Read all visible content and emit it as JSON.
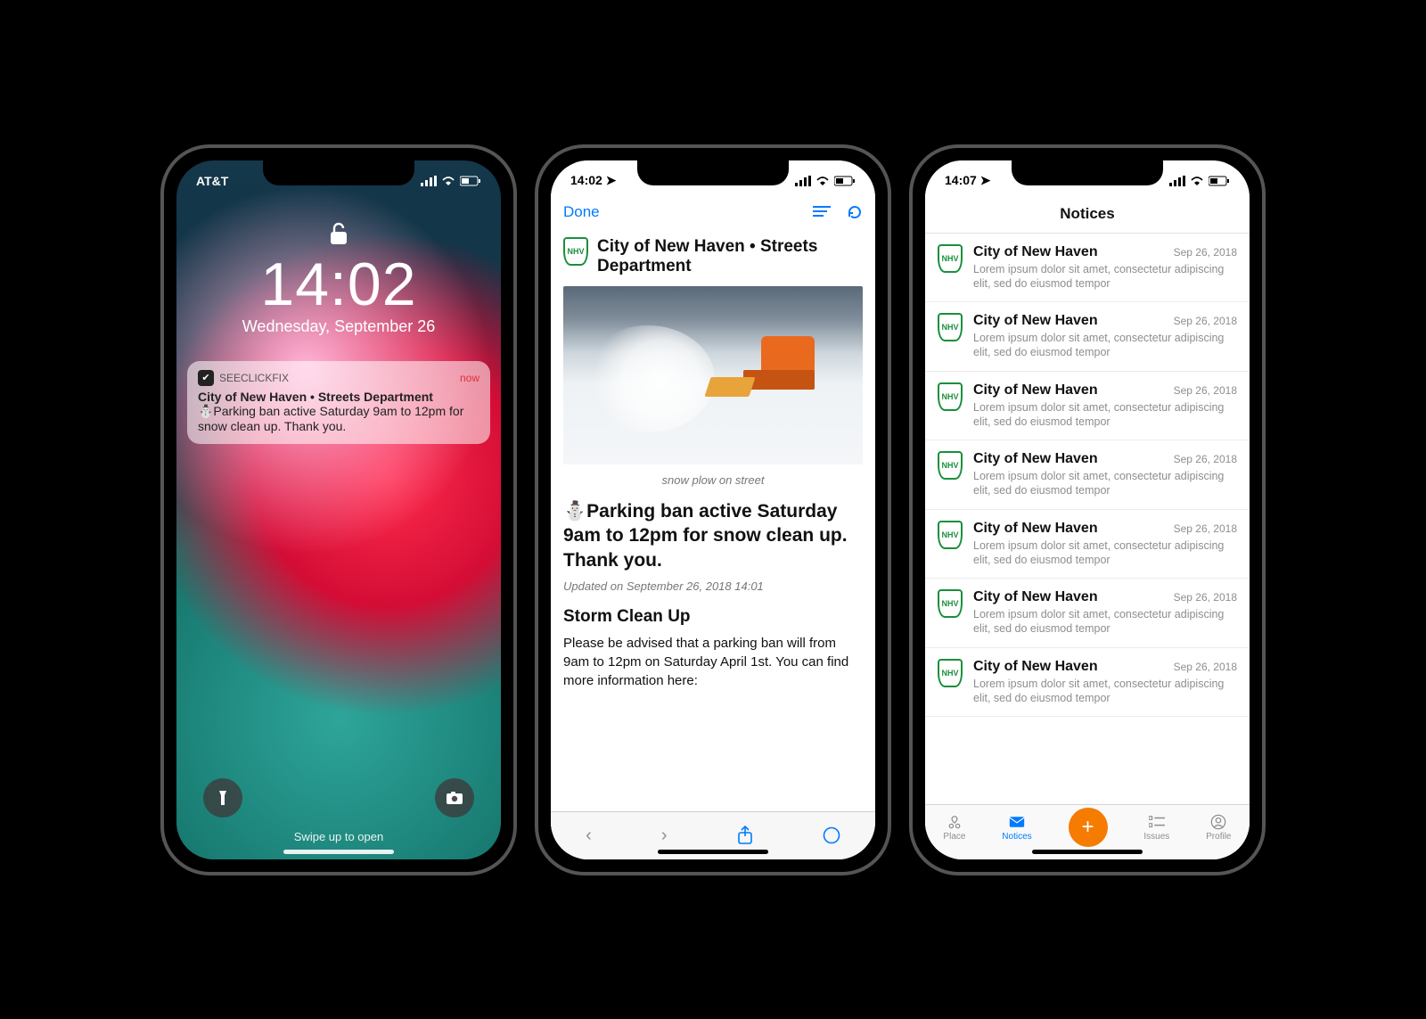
{
  "phone1": {
    "carrier": "AT&T",
    "time": "14:02",
    "date": "Wednesday, September 26",
    "notification": {
      "app_name": "SEECLICKFIX",
      "when": "now",
      "title": "City of New Haven • Streets Department",
      "body": "⛄Parking ban active Saturday 9am to 12pm for snow clean up. Thank you."
    },
    "swipe_hint": "Swipe up to open"
  },
  "phone2": {
    "time": "14:02",
    "done_label": "Done",
    "org_title": "City of New Haven • Streets Department",
    "image_caption": "snow plow on street",
    "headline": "⛄Parking ban active Saturday 9am to 12pm for snow clean up. Thank you.",
    "updated": "Updated on September 26, 2018 14:01",
    "subhead": "Storm Clean Up",
    "paragraph": "Please be advised that a parking ban will from 9am to 12pm on Saturday April 1st. You can find more information here:"
  },
  "phone3": {
    "time": "14:07",
    "header": "Notices",
    "tabs": {
      "place": "Place",
      "notices": "Notices",
      "issues": "Issues",
      "profile": "Profile"
    },
    "items": [
      {
        "title": "City of New Haven",
        "date": "Sep 26, 2018",
        "body": "Lorem ipsum dolor sit amet, consectetur adipiscing elit, sed do eiusmod tempor"
      },
      {
        "title": "City of New Haven",
        "date": "Sep 26, 2018",
        "body": "Lorem ipsum dolor sit amet, consectetur adipiscing elit, sed do eiusmod tempor"
      },
      {
        "title": "City of New Haven",
        "date": "Sep 26, 2018",
        "body": "Lorem ipsum dolor sit amet, consectetur adipiscing elit, sed do eiusmod tempor"
      },
      {
        "title": "City of New Haven",
        "date": "Sep 26, 2018",
        "body": "Lorem ipsum dolor sit amet, consectetur adipiscing elit, sed do eiusmod tempor"
      },
      {
        "title": "City of New Haven",
        "date": "Sep 26, 2018",
        "body": "Lorem ipsum dolor sit amet, consectetur adipiscing elit, sed do eiusmod tempor"
      },
      {
        "title": "City of New Haven",
        "date": "Sep 26, 2018",
        "body": "Lorem ipsum dolor sit amet, consectetur adipiscing elit, sed do eiusmod tempor"
      },
      {
        "title": "City of New Haven",
        "date": "Sep 26, 2018",
        "body": "Lorem ipsum dolor sit amet, consectetur adipiscing elit, sed do eiusmod tempor"
      }
    ]
  }
}
